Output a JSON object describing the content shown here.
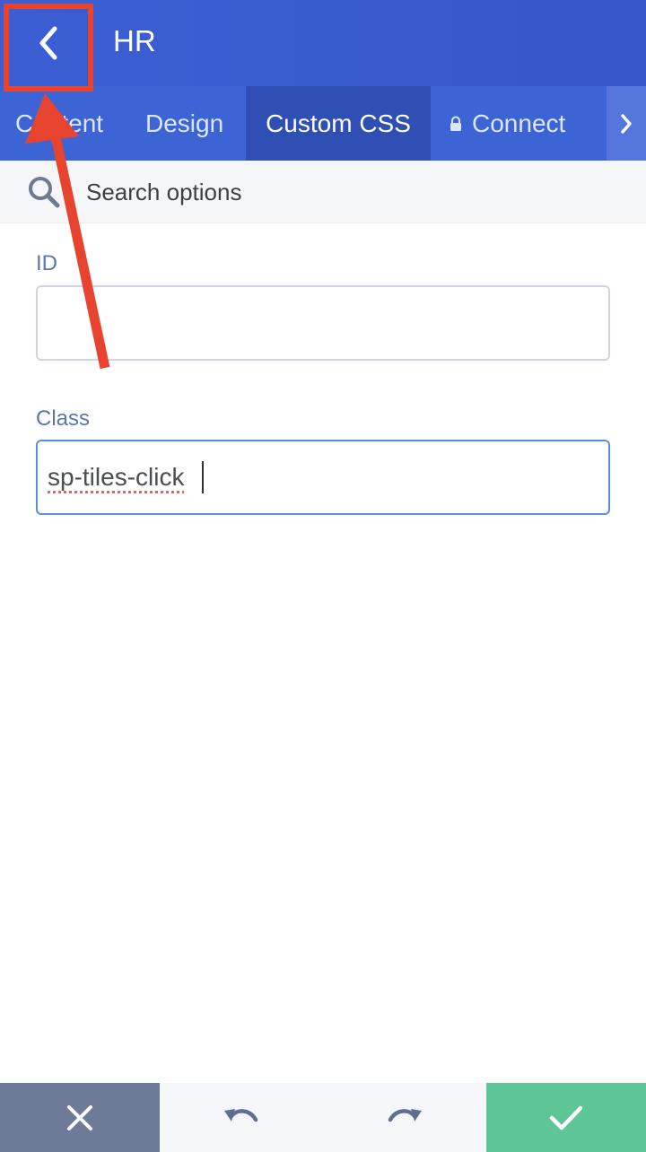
{
  "header": {
    "title": "HR",
    "back_icon": "chevron-left-icon"
  },
  "tabs": [
    {
      "label": "Content",
      "active": false
    },
    {
      "label": "Design",
      "active": false
    },
    {
      "label": "Custom CSS",
      "active": true
    },
    {
      "label": "Connect",
      "active": false,
      "icon": "lock-icon"
    }
  ],
  "tabs_next_icon": "chevron-right-icon",
  "search": {
    "placeholder": "Search options",
    "icon": "search-icon"
  },
  "form": {
    "id_label": "ID",
    "id_value": "",
    "class_label": "Class",
    "class_value": "sp-tiles-click"
  },
  "footer": {
    "cancel_icon": "close-icon",
    "undo_icon": "undo-icon",
    "redo_icon": "redo-icon",
    "apply_icon": "check-icon"
  },
  "colors": {
    "header": "#3b5fd3",
    "active_tab": "#2f4fb4",
    "cancel": "#6d7b99",
    "apply": "#5dc596",
    "annotation": "#e8432f"
  }
}
